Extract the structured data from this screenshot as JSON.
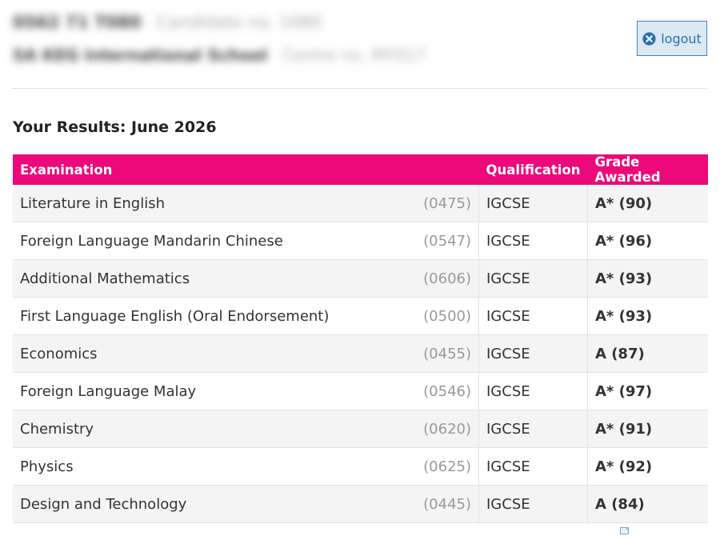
{
  "header": {
    "candidate_name": "0562 71 T080",
    "candidate_sub": "Candidate no. 1080",
    "school_name": "SA KEG International School",
    "school_sub": "Centre no. MY017"
  },
  "logout": {
    "label": "logout",
    "icon": "close-circle-icon"
  },
  "results": {
    "title": "Your Results: June 2026",
    "columns": {
      "examination": "Examination",
      "qualification": "Qualification",
      "grade": "Grade Awarded"
    },
    "rows": [
      {
        "exam": "Literature in English",
        "code": "(0475)",
        "qualification": "IGCSE",
        "grade": "A* (90)"
      },
      {
        "exam": "Foreign Language Mandarin Chinese",
        "code": "(0547)",
        "qualification": "IGCSE",
        "grade": "A* (96)"
      },
      {
        "exam": "Additional Mathematics",
        "code": "(0606)",
        "qualification": "IGCSE",
        "grade": "A* (93)"
      },
      {
        "exam": "First Language English (Oral Endorsement)",
        "code": "(0500)",
        "qualification": "IGCSE",
        "grade": "A* (93)"
      },
      {
        "exam": "Economics",
        "code": "(0455)",
        "qualification": "IGCSE",
        "grade": "A (87)"
      },
      {
        "exam": "Foreign Language Malay",
        "code": "(0546)",
        "qualification": "IGCSE",
        "grade": "A* (97)"
      },
      {
        "exam": "Chemistry",
        "code": "(0620)",
        "qualification": "IGCSE",
        "grade": "A* (91)"
      },
      {
        "exam": "Physics",
        "code": "(0625)",
        "qualification": "IGCSE",
        "grade": "A* (92)"
      },
      {
        "exam": "Design and Technology",
        "code": "(0445)",
        "qualification": "IGCSE",
        "grade": "A (84)"
      }
    ]
  },
  "colors": {
    "header_accent": "#ec0a7a",
    "logout_border": "#3a82c4",
    "logout_bg": "#dbe9f5"
  }
}
